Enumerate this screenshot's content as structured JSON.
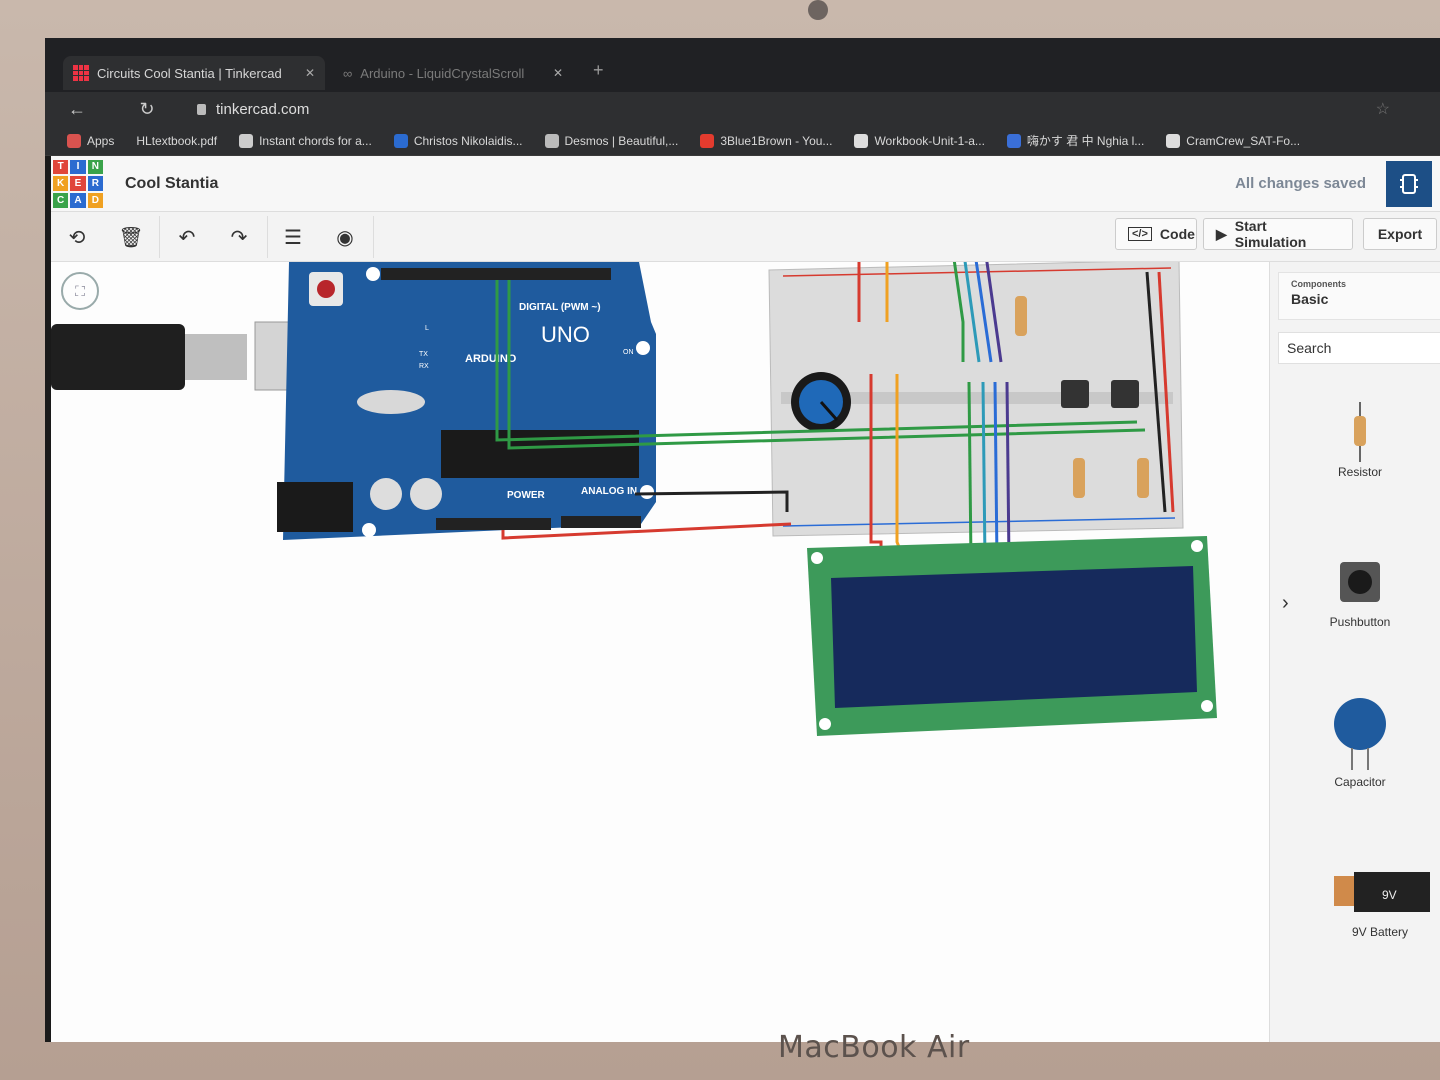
{
  "browser": {
    "tabs": [
      {
        "label": "Circuits Cool Stantia | Tinkercad",
        "active": true
      },
      {
        "label": "Arduino - LiquidCrystalScroll",
        "active": false
      }
    ],
    "url": "tinkercad.com",
    "bookmarks": [
      {
        "label": "Apps",
        "icon": "apps-grid-icon",
        "color": "#d9534f"
      },
      {
        "label": "HLtextbook.pdf",
        "icon": "",
        "color": ""
      },
      {
        "label": "Instant chords for a...",
        "icon": "moon-icon",
        "color": "#cccccc"
      },
      {
        "label": "Christos Nikolaidis...",
        "icon": "w-icon",
        "color": "#2b6bd0"
      },
      {
        "label": "Desmos | Beautiful,...",
        "icon": "desmos-icon",
        "color": "#bbbbbb"
      },
      {
        "label": "3Blue1Brown - You...",
        "icon": "youtube-icon",
        "color": "#e33b2e"
      },
      {
        "label": "Workbook-Unit-1-a...",
        "icon": "globe-icon",
        "color": "#dddddd"
      },
      {
        "label": "嗨かす 君 中 Nghia l...",
        "icon": "h-icon",
        "color": "#3a6fd8"
      },
      {
        "label": "CramCrew_SAT-Fo...",
        "icon": "globe-icon",
        "color": "#dddddd"
      }
    ]
  },
  "app": {
    "logo_letters": [
      "T",
      "I",
      "N",
      "K",
      "E",
      "R",
      "C",
      "A",
      "D"
    ],
    "project_title": "Cool Stantia",
    "save_status": "All changes saved",
    "toolbar": {
      "code_label": "Code",
      "start_simulation_label": "Start Simulation",
      "export_label": "Export"
    },
    "panel": {
      "components_label": "Components",
      "category": "Basic",
      "search_placeholder": "Search",
      "components": [
        "Resistor",
        "Pushbutton",
        "Capacitor",
        "9V Battery"
      ]
    },
    "board": {
      "model": "UNO",
      "brand": "ARDUINO",
      "labels": {
        "digital": "DIGITAL (PWM ~)",
        "power": "POWER",
        "analog": "ANALOG IN",
        "on": "ON",
        "tx": "TX",
        "rx": "RX",
        "l": "L"
      }
    },
    "battery_label": "9V"
  },
  "device": {
    "brand": "MacBook Air"
  },
  "colors": {
    "tinkercad_blue": "#1d4f86",
    "arduino_blue": "#1f5b9e",
    "wire_red": "#d63a2f",
    "wire_orange": "#f0a122",
    "wire_green": "#2f9a45",
    "wire_teal": "#2d9ab8",
    "wire_blue": "#2a6cd6",
    "wire_purple": "#4b3a8f",
    "wire_black": "#222222",
    "lcd_green": "#3d9a5a",
    "lcd_screen": "#162a5c"
  }
}
